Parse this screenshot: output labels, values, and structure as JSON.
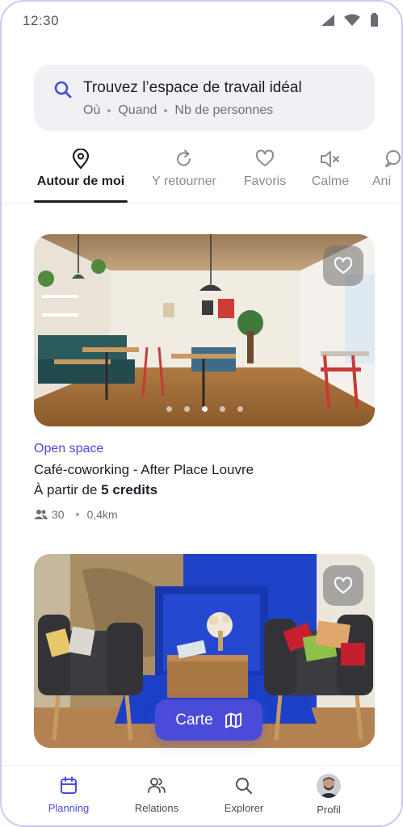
{
  "status_bar": {
    "time": "12:30"
  },
  "search": {
    "title": "Trouvez l’espace de travail idéal",
    "filters": [
      "Où",
      "Quand",
      "Nb de personnes"
    ]
  },
  "tabs": [
    {
      "label": "Autour de moi",
      "icon": "location-pin-icon",
      "active": true
    },
    {
      "label": "Y retourner",
      "icon": "refresh-icon",
      "active": false
    },
    {
      "label": "Favoris",
      "icon": "heart-icon",
      "active": false
    },
    {
      "label": "Calme",
      "icon": "speaker-mute-icon",
      "active": false
    },
    {
      "label": "Ani",
      "icon": "chat-icon",
      "active": false
    }
  ],
  "listings": [
    {
      "category": "Open space",
      "name": "Café-coworking - After Place Louvre",
      "price_prefix": "À partir de",
      "price_value": "5 credits",
      "capacity": "30",
      "distance": "0,4km",
      "photo_count": 5,
      "active_photo": 3
    },
    {
      "category": "",
      "name": "",
      "price_prefix": "",
      "price_value": "",
      "capacity": "",
      "distance": ""
    }
  ],
  "map_button": {
    "label": "Carte",
    "icon": "map-icon"
  },
  "bottom_nav": [
    {
      "label": "Planning",
      "icon": "calendar-icon",
      "active": true
    },
    {
      "label": "Relations",
      "icon": "people-icon",
      "active": false
    },
    {
      "label": "Explorer",
      "icon": "search-icon",
      "active": false
    },
    {
      "label": "Profil",
      "icon": "avatar",
      "active": false
    }
  ],
  "colors": {
    "accent": "#4a4bd8",
    "text": "#1e1e2a",
    "muted": "#8a8a94",
    "search_bg": "#f0f0f5",
    "frame": "#cdc7ee"
  }
}
